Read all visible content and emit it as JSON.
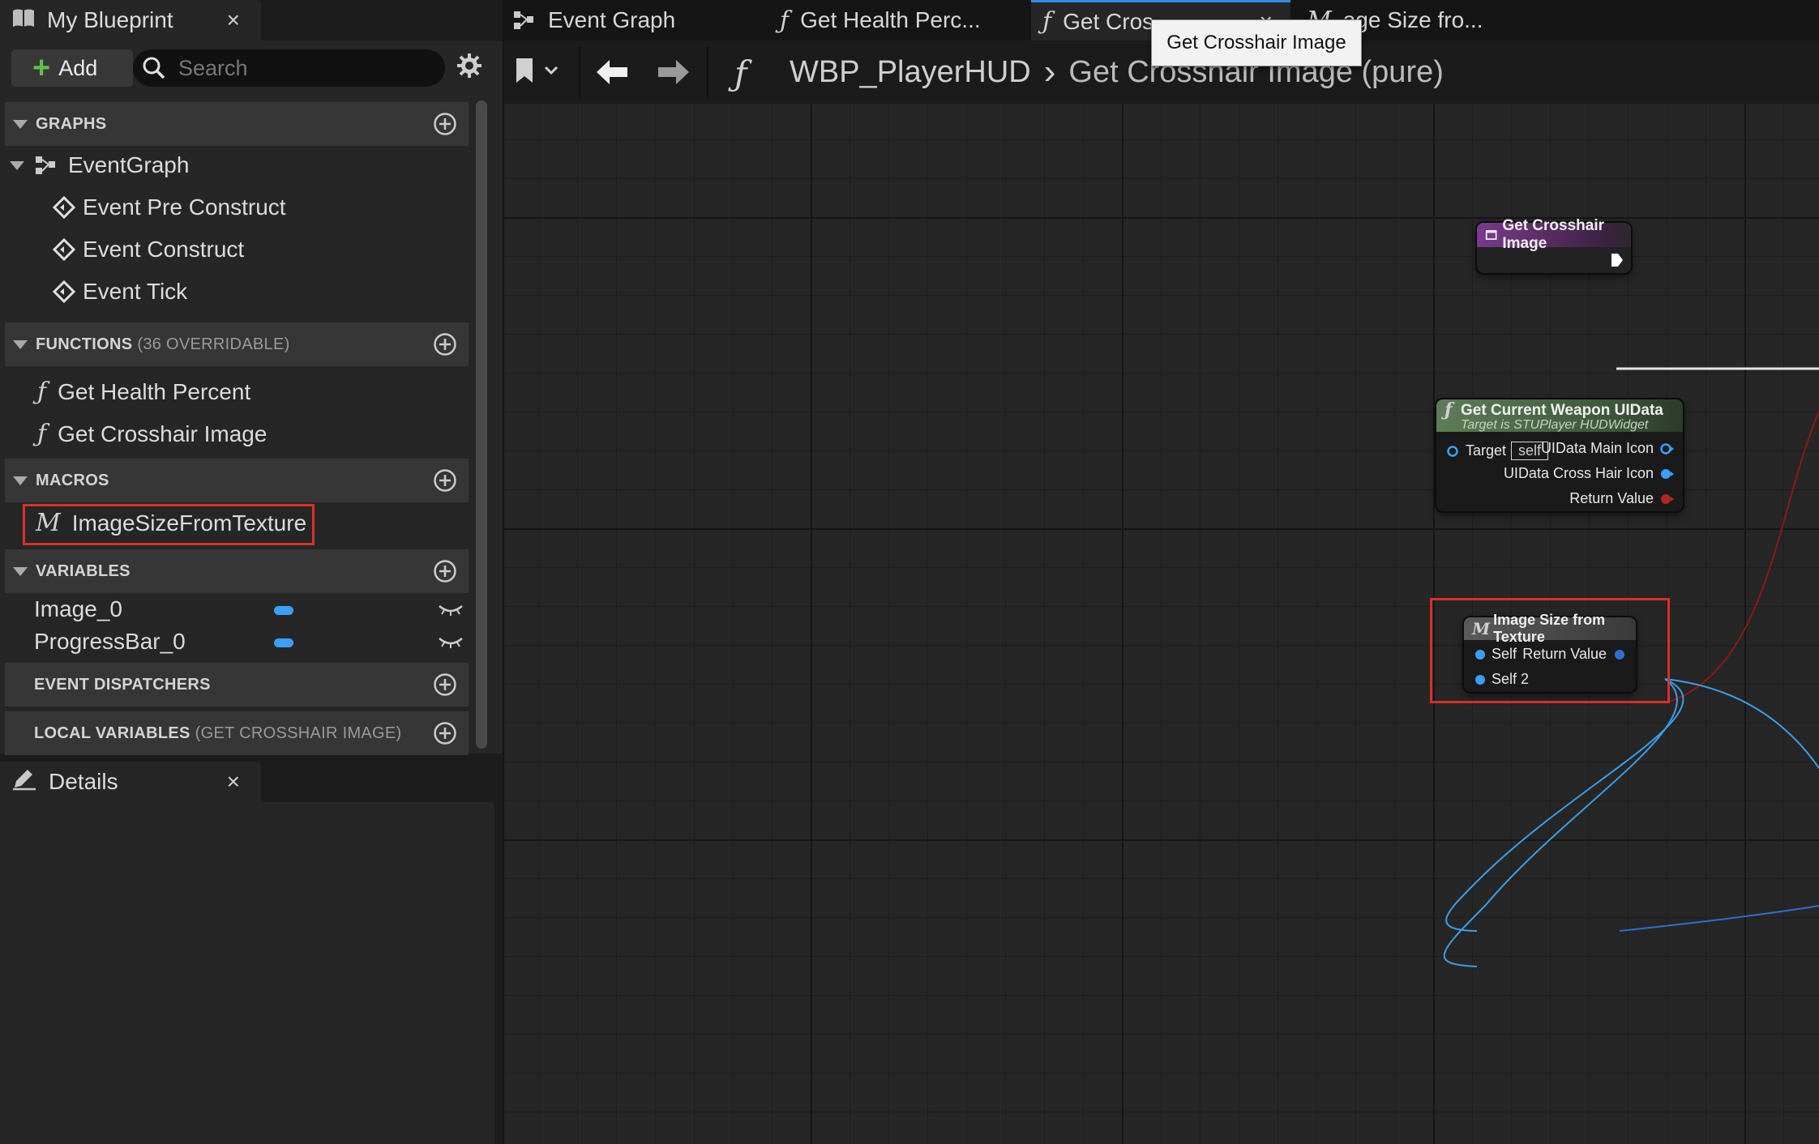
{
  "colors": {
    "accent_tab": "#2f8de4",
    "function_node": "#7a3a8c",
    "pure_node": "#5d7d58",
    "macro_node": "#5a5a5a",
    "object_pin": "#3aa0ff",
    "struct_pin_red": "#b0281e",
    "highlight_box": "#d9302a",
    "add_plus": "#5fc24b"
  },
  "left_panel": {
    "tab_title": "My Blueprint",
    "tab_icon": "book-icon",
    "close_label": "×",
    "add_label": "Add",
    "search_placeholder": "Search",
    "sections": {
      "graphs": {
        "label": "GRAPHS"
      },
      "functions": {
        "label": "FUNCTIONS",
        "sub": "(36 OVERRIDABLE)"
      },
      "macros": {
        "label": "MACROS"
      },
      "variables": {
        "label": "VARIABLES"
      },
      "dispatchers": {
        "label": "EVENT DISPATCHERS"
      },
      "local_vars": {
        "label": "LOCAL VARIABLES",
        "sub": "(GET CROSSHAIR IMAGE)"
      }
    },
    "graphs": {
      "root": "EventGraph",
      "events": [
        "Event Pre Construct",
        "Event Construct",
        "Event Tick"
      ]
    },
    "functions": [
      "Get Health Percent",
      "Get Crosshair Image"
    ],
    "macros": [
      "ImageSizeFromTexture"
    ],
    "variables": [
      "Image_0",
      "ProgressBar_0"
    ]
  },
  "details_panel": {
    "tab_title": "Details",
    "close_label": "×"
  },
  "doc_tabs": [
    {
      "label": "Event Graph",
      "icon": "event-graph-icon"
    },
    {
      "label": "Get Health Perc...",
      "icon": "function-icon"
    },
    {
      "label": "Get Cros",
      "icon": "function-icon",
      "close": "×"
    },
    {
      "label": "age Size fro...",
      "icon": "macro-icon"
    }
  ],
  "tooltip": "Get Crosshair Image",
  "breadcrumb": {
    "blueprint": "WBP_PlayerHUD",
    "separator": "›",
    "current": "Get Crosshair Image (pure)"
  },
  "nodes": {
    "entry": {
      "title": "Get Crosshair Image"
    },
    "weapon": {
      "title": "Get Current Weapon UIData",
      "subtitle": "Target is STUPlayer HUDWidget",
      "target_label": "Target",
      "target_value": "self",
      "outputs": [
        "UIData Main Icon",
        "UIData Cross Hair Icon",
        "Return Value"
      ]
    },
    "macro": {
      "title": "Image Size from Texture",
      "inputs": [
        "Self",
        "Self 2"
      ],
      "output": "Return Value"
    }
  },
  "icon_glyphs": {
    "function": "ƒ",
    "macro": "M"
  }
}
